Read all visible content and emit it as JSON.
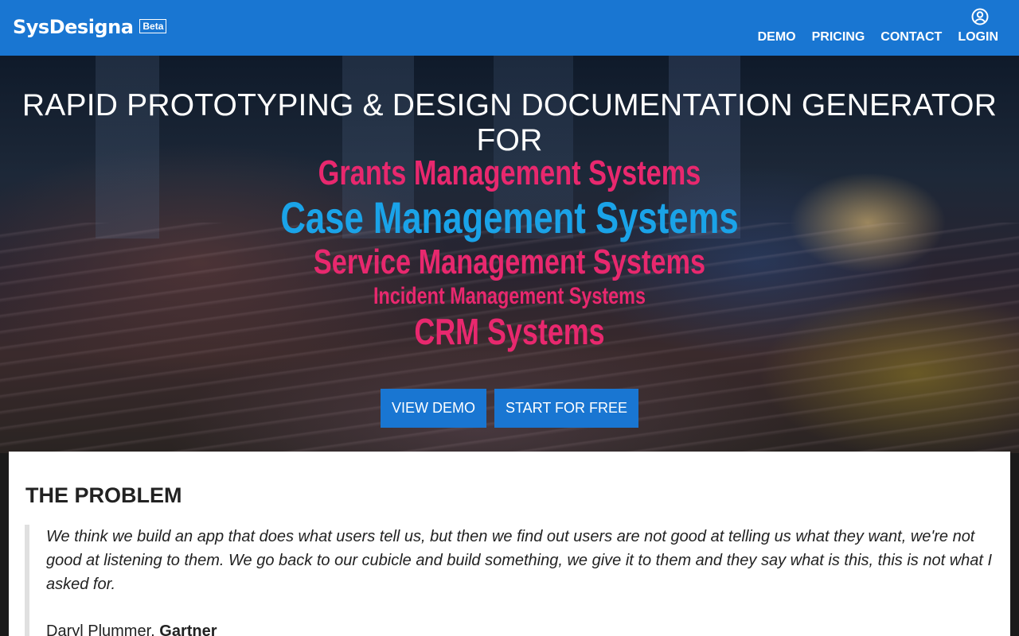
{
  "header": {
    "brand": "SysDesigna",
    "badge": "Beta",
    "nav": [
      "DEMO",
      "PRICING",
      "CONTACT",
      "LOGIN"
    ],
    "user_icon": "account-circle-icon"
  },
  "hero": {
    "headline": "RAPID PROTOTYPING & DESIGN DOCUMENTATION GENERATOR FOR",
    "systems": [
      "Grants Management Systems",
      "Case Management Systems",
      "Service Management Systems",
      "Incident Management Systems",
      "CRM Systems"
    ],
    "buttons": {
      "demo": "VIEW DEMO",
      "start": "START FOR FREE"
    }
  },
  "problem": {
    "title": "THE PROBLEM",
    "quote": "We think we build an app that does what users tell us, but then we find out users are not good at telling us what they want, we're not good at listening to them. We go back to our cubicle and build something, we give it to them and they say what is this, this is not what I asked for.",
    "author": "Daryl Plummer,",
    "org": "Gartner"
  },
  "colors": {
    "primary": "#1976d2",
    "pink": "#e8286e",
    "cyan": "#1aa3e8"
  }
}
